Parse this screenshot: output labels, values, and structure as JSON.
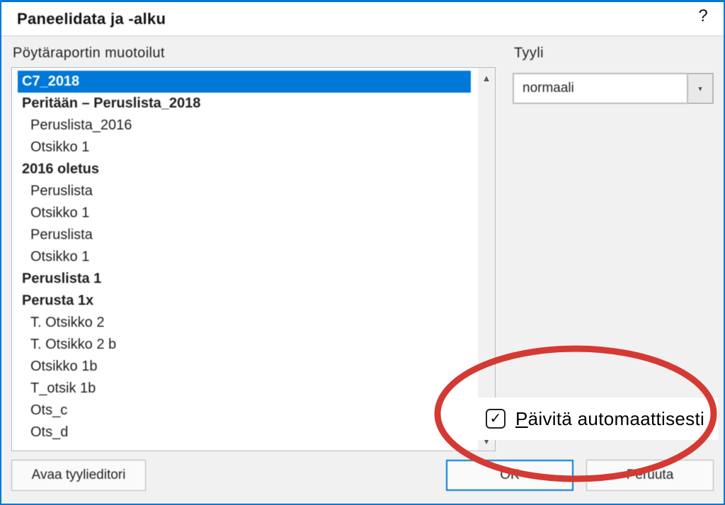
{
  "title": "Paneelidata ja -alku",
  "help_glyph": "?",
  "labels": {
    "left_section": "Pöytäraportin muotoilut",
    "right_section": "Tyyli"
  },
  "dropdown": {
    "value": "normaali",
    "arrow": "▾"
  },
  "listbox_items": [
    {
      "text": "C7_2018",
      "selected": true,
      "depth": 0
    },
    {
      "text": "Peritään – Peruslista_2018",
      "depth": 0
    },
    {
      "text": "Peruslista_2016",
      "depth": 1
    },
    {
      "text": "Otsikko 1",
      "depth": 1
    },
    {
      "text": "2016 oletus",
      "depth": 0
    },
    {
      "text": "Peruslista",
      "depth": 1
    },
    {
      "text": "Otsikko 1",
      "depth": 1
    },
    {
      "text": "Peruslista",
      "depth": 1
    },
    {
      "text": "Otsikko 1",
      "depth": 1
    },
    {
      "text": "Peruslista 1",
      "depth": 0
    },
    {
      "text": "Perusta 1x",
      "depth": 0
    },
    {
      "text": "T. Otsikko 2",
      "depth": 1
    },
    {
      "text": "T. Otsikko 2 b",
      "depth": 1
    },
    {
      "text": "Otsikko 1b",
      "depth": 1
    },
    {
      "text": "T_otsik 1b",
      "depth": 1
    },
    {
      "text": "Ots_c",
      "depth": 1
    },
    {
      "text": "Ots_d",
      "depth": 1
    }
  ],
  "checkbox": {
    "label": "Päivitä automaattisesti",
    "checked": true
  },
  "buttons": {
    "left": "Avaa tyylieditori",
    "ok": "OK",
    "cancel": "Peruuta"
  }
}
